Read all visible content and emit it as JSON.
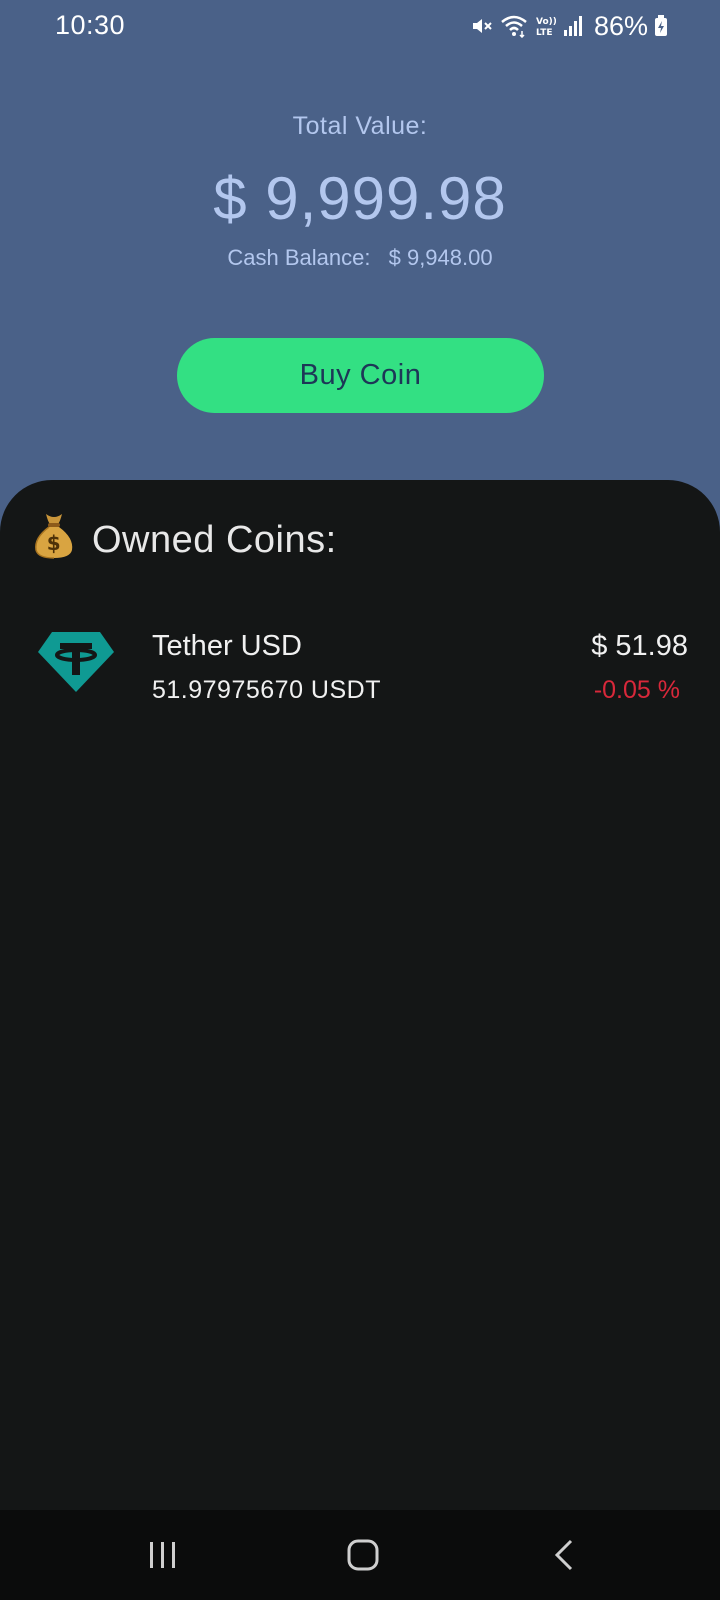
{
  "status_bar": {
    "time": "10:30",
    "battery": "86%",
    "icons": [
      "mute-icon",
      "wifi-icon",
      "volte-icon",
      "signal-icon",
      "battery-charging-icon"
    ]
  },
  "header": {
    "total_label": "Total Value:",
    "total_value": "$ 9,999.98",
    "cash_label": "Cash Balance:",
    "cash_value": "$ 9,948.00",
    "buy_button": "Buy Coin"
  },
  "owned": {
    "title": "Owned Coins:",
    "title_icon": "money-bag-icon",
    "coins": [
      {
        "name": "Tether USD",
        "amount": "51.97975670 USDT",
        "value": "$ 51.98",
        "change": "-0.05 %",
        "icon": "tether-logo-icon"
      }
    ]
  },
  "colors": {
    "header_bg": "#4a6188",
    "header_text": "#b3c7ee",
    "button_bg": "#33e083",
    "button_text": "#1d3757",
    "panel_bg": "#141616",
    "negative": "#d8283a",
    "tether": "#0f9a93"
  },
  "nav": {
    "icons": [
      "recent-apps-icon",
      "home-icon",
      "back-icon"
    ]
  }
}
